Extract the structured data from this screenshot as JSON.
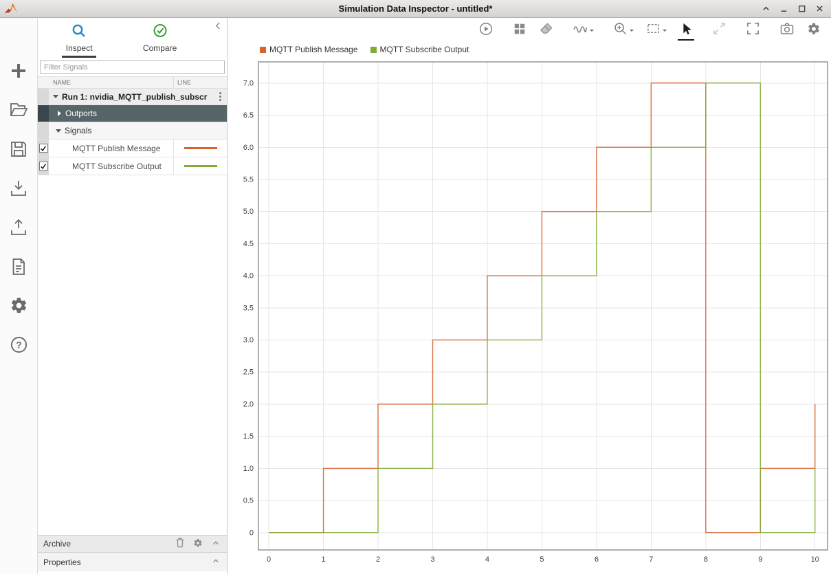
{
  "window": {
    "title": "Simulation Data Inspector - untitled*",
    "controls": [
      {
        "name": "shade",
        "icon": "chevron-up-icon"
      },
      {
        "name": "minimize",
        "icon": "minimize-icon"
      },
      {
        "name": "maximize",
        "icon": "maximize-icon"
      },
      {
        "name": "close",
        "icon": "close-icon"
      }
    ]
  },
  "left_toolbar": [
    {
      "name": "add",
      "icon": "plus-icon"
    },
    {
      "name": "open",
      "icon": "folder-open-icon"
    },
    {
      "name": "save",
      "icon": "save-icon"
    },
    {
      "name": "import",
      "icon": "import-icon"
    },
    {
      "name": "export",
      "icon": "export-icon"
    },
    {
      "name": "create-report",
      "icon": "report-icon"
    },
    {
      "name": "preferences",
      "icon": "gear-icon"
    },
    {
      "name": "help",
      "icon": "help-icon"
    }
  ],
  "sidebar": {
    "tabs": [
      {
        "label": "Inspect",
        "icon": "magnifier-icon",
        "active": true
      },
      {
        "label": "Compare",
        "icon": "check-circle-icon",
        "active": false
      }
    ],
    "filter": {
      "placeholder": "Filter Signals"
    },
    "columns": {
      "name": "NAME",
      "line": "LINE"
    },
    "run": {
      "label": "Run 1: nvidia_MQTT_publish_subscr"
    },
    "groups": [
      {
        "label": "Outports",
        "state": "collapsed",
        "selected": true
      },
      {
        "label": "Signals",
        "state": "expanded",
        "selected": false
      }
    ],
    "signals": [
      {
        "label": "MQTT Publish Message",
        "checked": true,
        "color": "#d9632e"
      },
      {
        "label": "MQTT Subscribe Output",
        "checked": true,
        "color": "#80ad35"
      }
    ],
    "archive": {
      "label": "Archive"
    },
    "properties": {
      "label": "Properties"
    }
  },
  "plot_toolbar": [
    {
      "name": "replay",
      "icon": "play-circle-icon"
    },
    {
      "name": "layout",
      "icon": "grid-layout-icon"
    },
    {
      "name": "clear-plots",
      "icon": "eraser-icon"
    },
    {
      "name": "line-style",
      "icon": "signal-wave-icon",
      "has_menu": true
    },
    {
      "name": "zoom",
      "icon": "zoom-icon",
      "has_menu": true
    },
    {
      "name": "zoom-region",
      "icon": "selection-box-icon",
      "has_menu": true
    },
    {
      "name": "pointer",
      "icon": "cursor-icon",
      "active": true
    },
    {
      "name": "fit-to-view",
      "icon": "expand-arrows-icon",
      "disabled": true
    },
    {
      "name": "fullscreen",
      "icon": "fullscreen-icon"
    },
    {
      "name": "snapshot",
      "icon": "camera-icon"
    },
    {
      "name": "settings",
      "icon": "gear-icon"
    }
  ],
  "chart_data": {
    "type": "line",
    "line_shape": "step-after",
    "title": "",
    "xlabel": "",
    "ylabel": "",
    "grid": true,
    "legend_position": "top-left",
    "xlim": [
      -0.19,
      10.23
    ],
    "ylim": [
      -0.27,
      7.33
    ],
    "xticks": [
      0,
      1,
      2,
      3,
      4,
      5,
      6,
      7,
      8,
      9,
      10
    ],
    "xtick_labels": [
      "0",
      "1",
      "2",
      "3",
      "4",
      "5",
      "6",
      "7",
      "8",
      "9",
      "10"
    ],
    "yticks": [
      0,
      0.5,
      1,
      1.5,
      2,
      2.5,
      3,
      3.5,
      4,
      4.5,
      5,
      5.5,
      6,
      6.5,
      7
    ],
    "ytick_labels": [
      "0",
      "0.5",
      "1.0",
      "1.5",
      "2.0",
      "2.5",
      "3.0",
      "3.5",
      "4.0",
      "4.5",
      "5.0",
      "5.5",
      "6.0",
      "6.5",
      "7.0"
    ],
    "series": [
      {
        "name": "MQTT Publish Message",
        "color": "#d9632e",
        "points": [
          [
            0,
            0
          ],
          [
            1,
            1
          ],
          [
            2,
            2
          ],
          [
            3,
            3
          ],
          [
            4,
            4
          ],
          [
            5,
            5
          ],
          [
            6,
            6
          ],
          [
            7,
            7
          ],
          [
            8,
            0
          ],
          [
            9,
            1
          ],
          [
            10,
            2
          ]
        ]
      },
      {
        "name": "MQTT Subscribe Output",
        "color": "#80ad35",
        "points": [
          [
            0,
            0
          ],
          [
            2,
            1
          ],
          [
            3,
            2
          ],
          [
            4,
            3
          ],
          [
            5,
            4
          ],
          [
            6,
            5
          ],
          [
            7,
            6
          ],
          [
            8,
            7
          ],
          [
            9,
            0
          ],
          [
            10,
            1
          ]
        ]
      }
    ]
  }
}
